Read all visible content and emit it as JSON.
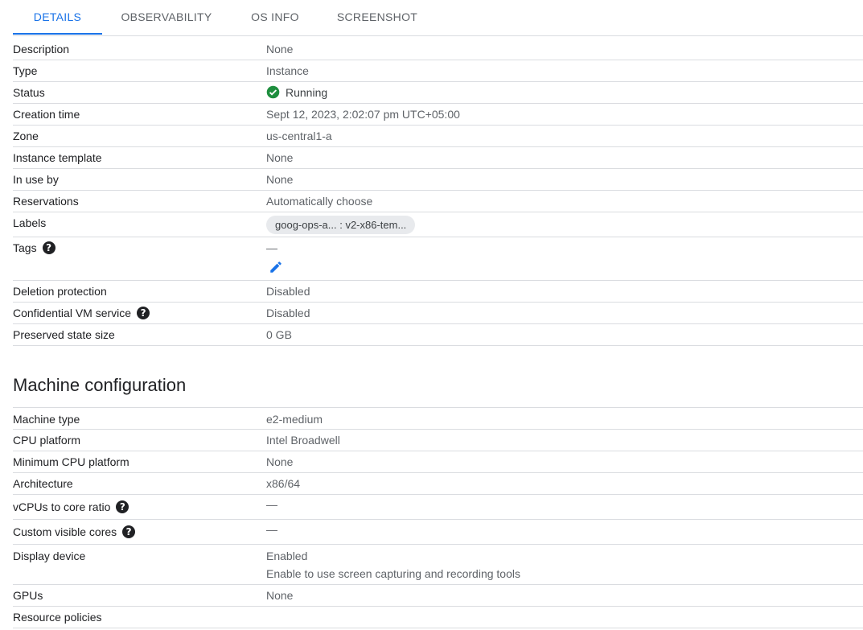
{
  "tabs": [
    {
      "label": "DETAILS",
      "active": true
    },
    {
      "label": "OBSERVABILITY",
      "active": false
    },
    {
      "label": "OS INFO",
      "active": false
    },
    {
      "label": "SCREENSHOT",
      "active": false
    }
  ],
  "details": {
    "description": {
      "label": "Description",
      "value": "None"
    },
    "type": {
      "label": "Type",
      "value": "Instance"
    },
    "status": {
      "label": "Status",
      "value": "Running",
      "icon": "check-circle-icon",
      "color": "#1e8e3e"
    },
    "creation_time": {
      "label": "Creation time",
      "value": "Sept 12, 2023, 2:02:07 pm UTC+05:00"
    },
    "zone": {
      "label": "Zone",
      "value": "us-central1-a"
    },
    "instance_template": {
      "label": "Instance template",
      "value": "None"
    },
    "in_use_by": {
      "label": "In use by",
      "value": "None"
    },
    "reservations": {
      "label": "Reservations",
      "value": "Automatically choose"
    },
    "labels": {
      "label": "Labels",
      "chip": "goog-ops-a... : v2-x86-tem..."
    },
    "tags": {
      "label": "Tags",
      "value": "—",
      "edit_icon": "pencil-icon"
    },
    "deletion_protection": {
      "label": "Deletion protection",
      "value": "Disabled"
    },
    "confidential_vm": {
      "label": "Confidential VM service",
      "value": "Disabled"
    },
    "preserved_state_size": {
      "label": "Preserved state size",
      "value": "0 GB"
    }
  },
  "machine": {
    "title": "Machine configuration",
    "machine_type": {
      "label": "Machine type",
      "value": "e2-medium"
    },
    "cpu_platform": {
      "label": "CPU platform",
      "value": "Intel Broadwell"
    },
    "min_cpu_platform": {
      "label": "Minimum CPU platform",
      "value": "None"
    },
    "architecture": {
      "label": "Architecture",
      "value": "x86/64"
    },
    "vcpus_ratio": {
      "label": "vCPUs to core ratio",
      "value": "—"
    },
    "custom_cores": {
      "label": "Custom visible cores",
      "value": "—"
    },
    "display_device": {
      "label": "Display device",
      "value": "Enabled",
      "sub": "Enable to use screen capturing and recording tools"
    },
    "gpus": {
      "label": "GPUs",
      "value": "None"
    },
    "resource_policies": {
      "label": "Resource policies",
      "value": ""
    }
  },
  "colors": {
    "accent": "#1a73e8",
    "success": "#1e8e3e",
    "edit": "#1a73e8"
  }
}
